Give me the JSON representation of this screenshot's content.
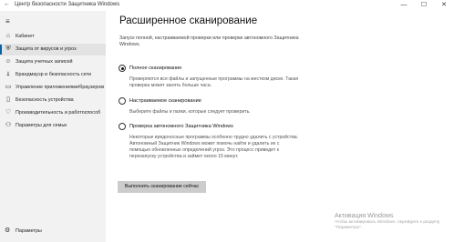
{
  "window": {
    "title": "Центр безопасности Защитника Windows",
    "back_icon": "←",
    "minimize": "—",
    "maximize": "☐",
    "close": "✕"
  },
  "sidebar": {
    "menu_icon": "≡",
    "items": [
      {
        "icon": "⌂",
        "label": "Кабинет",
        "active": false
      },
      {
        "icon": "⛨",
        "label": "Защита от вирусов и угроз",
        "active": true
      },
      {
        "icon": "☺",
        "label": "Защита учетных записей",
        "active": false
      },
      {
        "icon": "⍋",
        "label": "Брандмауэр и безопасность сети",
        "active": false
      },
      {
        "icon": "▭",
        "label": "Управление приложениями/браузером",
        "active": false
      },
      {
        "icon": "▯",
        "label": "Безопасность устройства",
        "active": false
      },
      {
        "icon": "♡",
        "label": "Производительность и работоспособ",
        "active": false
      },
      {
        "icon": "⚇",
        "label": "Параметры для семьи",
        "active": false
      }
    ],
    "settings": {
      "icon": "⚙",
      "label": "Параметры"
    }
  },
  "main": {
    "title": "Расширенное сканирование",
    "intro": "Запуск полной, настраиваемой проверки или проверки автономного Защитника Windows.",
    "options": [
      {
        "label": "Полное сканирование",
        "checked": true,
        "description": "Проверяются все файлы и запущенные программы на жестком диске. Такая проверка может занять больше часа."
      },
      {
        "label": "Настраиваемое сканирование",
        "checked": false,
        "description": "Выберите файлы и папки, которые следует проверить."
      },
      {
        "label": "Проверка автономного Защитника Windows",
        "checked": false,
        "description": "Некоторые вредоносные программы особенно трудно удалить с устройства. Автономный Защитник Windows может помочь найти и удалить их с помощью обновленных определений угроз. Это процесс приведет к перезапуску устройства и займет около 15 минут."
      }
    ],
    "scan_button": "Выполнить сканирование сейчас"
  },
  "watermark": {
    "title": "Активация Windows",
    "text": "Чтобы активировать Windows, перейдите к разделу \"Параметры\"."
  }
}
